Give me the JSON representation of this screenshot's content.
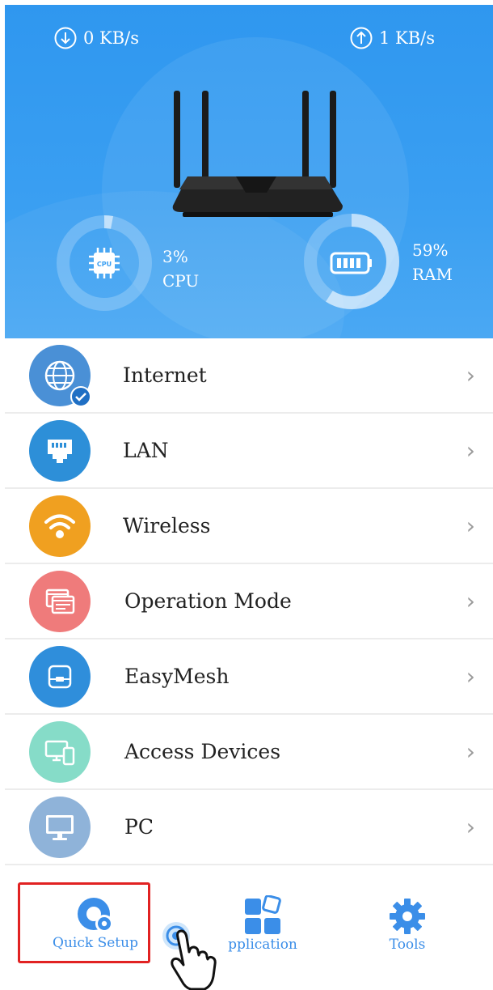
{
  "status": {
    "download": "0 KB/s",
    "upload": "1 KB/s"
  },
  "cpu": {
    "percent_label": "3%",
    "label": "CPU",
    "icon_text": "CPU",
    "value": 3
  },
  "ram": {
    "percent_label": "59%",
    "label": "RAM",
    "value": 59
  },
  "menu": [
    {
      "label": "Internet",
      "color": "#4a90d6",
      "icon": "globe-icon"
    },
    {
      "label": "LAN",
      "color": "#2d8fd8",
      "icon": "ethernet-port-icon"
    },
    {
      "label": "Wireless",
      "color": "#f0a020",
      "icon": "wifi-icon"
    },
    {
      "label": "Operation Mode",
      "color": "#ef7b7b",
      "icon": "windows-stack-icon"
    },
    {
      "label": "EasyMesh",
      "color": "#2f8edb",
      "icon": "mesh-node-icon"
    },
    {
      "label": "Access Devices",
      "color": "#86dcc8",
      "icon": "devices-icon"
    },
    {
      "label": "PC",
      "color": "#8fb3d9",
      "icon": "monitor-icon"
    }
  ],
  "tabs": {
    "quick_setup": "Quick Setup",
    "application": "pplication",
    "tools": "Tools"
  },
  "colors": {
    "accent": "#3b8ee8",
    "highlight": "#e12222",
    "hero": "#3a9ff2"
  }
}
